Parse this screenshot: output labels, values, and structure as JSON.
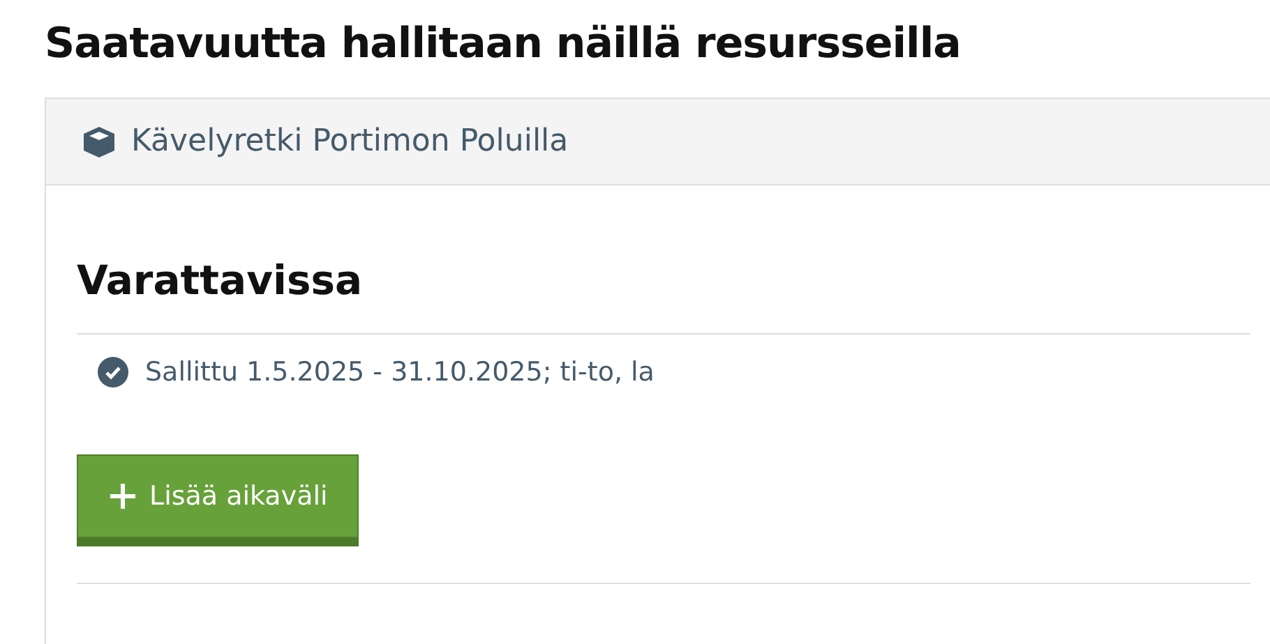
{
  "title": "Saatavuutta hallitaan näillä resursseilla",
  "resource": {
    "name": "Kävelyretki Portimon Poluilla"
  },
  "section": {
    "heading": "Varattavissa",
    "rules": [
      {
        "text": "Sallittu 1.5.2025 - 31.10.2025; ti-to, la"
      }
    ],
    "add_button": "Lisää aikaväli"
  }
}
